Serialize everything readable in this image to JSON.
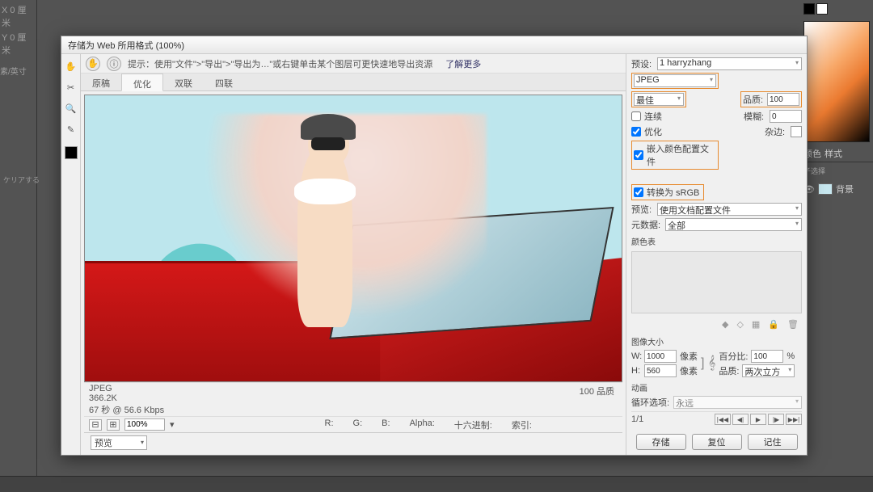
{
  "background": {
    "ruler_x": "X 0 厘米",
    "ruler_y": "Y 0 厘米",
    "unit_label": "素/英寸",
    "clear_text": "ケリアする",
    "right_tabs": {
      "color": "颜色",
      "swatches": "样式"
    },
    "sub_select": "子选择",
    "layer_label": "背景"
  },
  "dialog": {
    "title": "存储为 Web 所用格式 (100%)",
    "hint": "提示：使用\"文件\">\"导出\">\"导出为…\"或右键单击某个图层可更快速地导出资源",
    "learn_more": "了解更多",
    "tabs": {
      "original": "原稿",
      "optimized": "优化",
      "two_up": "双联",
      "four_up": "四联"
    },
    "info": {
      "format": "JPEG",
      "size": "366.2K",
      "time": "67 秒 @ 56.6 Kbps",
      "quality_label": "100 品质"
    },
    "zoom": {
      "value": "100%"
    },
    "readout": {
      "r": "R:",
      "g": "G:",
      "b": "B:",
      "alpha": "Alpha:",
      "hex": "十六进制:",
      "index": "索引:"
    },
    "preview_label": "预览"
  },
  "settings": {
    "preset_label": "预设:",
    "preset_value": "1 harryzhang",
    "format": "JPEG",
    "quality_row": {
      "label": "最佳",
      "q_label": "品质:",
      "q_value": "100"
    },
    "progressive": "连续",
    "blur_label": "模糊:",
    "blur_value": "0",
    "optimized": "优化",
    "matte_label": "杂边:",
    "embed_profile": "嵌入颜色配置文件",
    "convert_srgb": "转换为 sRGB",
    "preview_label": "预览:",
    "preview_value": "使用文档配置文件",
    "metadata_label": "元数据:",
    "metadata_value": "全部",
    "color_table_label": "颜色表",
    "image_size_label": "图像大小",
    "width": {
      "label": "W:",
      "value": "1000",
      "unit": "像素"
    },
    "height": {
      "label": "H:",
      "value": "560",
      "unit": "像素"
    },
    "percent_label": "百分比:",
    "percent_value": "100",
    "percent_unit": "%",
    "resample_label": "品质:",
    "resample_value": "两次立方",
    "animation_label": "动画",
    "loop_label": "循环选项:",
    "loop_value": "永远",
    "frame_counter": "1/1",
    "actions": {
      "save": "存储",
      "reset": "复位",
      "remember": "记住"
    }
  }
}
